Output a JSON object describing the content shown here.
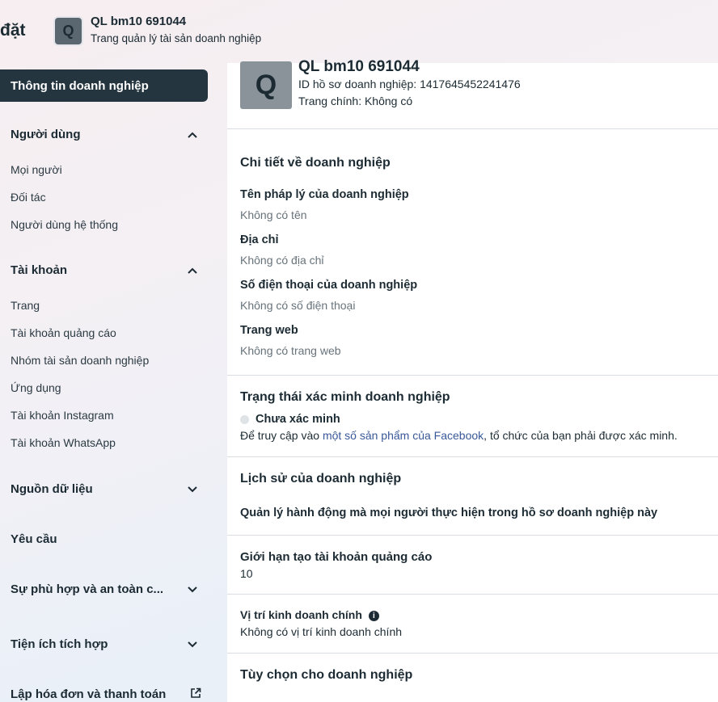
{
  "header": {
    "crumb_title": "đặt",
    "avatar_letter": "Q",
    "business_name": "QL bm10 691044",
    "subtitle": "Trang quản lý tài sản doanh nghiệp"
  },
  "sidebar": {
    "active_item": "Thông tin doanh nghiệp",
    "sections": {
      "users": {
        "label": "Người dùng",
        "items": [
          "Mọi người",
          "Đối tác",
          "Người dùng hệ thống"
        ]
      },
      "accounts": {
        "label": "Tài khoản",
        "items": [
          "Trang",
          "Tài khoản quảng cáo",
          "Nhóm tài sản doanh nghiệp",
          "Ứng dụng",
          "Tài khoản Instagram",
          "Tài khoản WhatsApp"
        ]
      },
      "data_sources": {
        "label": "Nguồn dữ liệu"
      },
      "requests": {
        "label": "Yêu cầu"
      },
      "compliance": {
        "label": "Sự phù hợp và an toàn c..."
      },
      "integrations": {
        "label": "Tiện ích tích hợp"
      },
      "billing": {
        "label": "Lập hóa đơn và thanh toán"
      }
    }
  },
  "main": {
    "profile": {
      "avatar_letter": "Q",
      "name": "QL bm10 691044",
      "id_line": "ID hồ sơ doanh nghiệp: 1417645452241476",
      "page_line": "Trang chính: Không có"
    },
    "details": {
      "heading": "Chi tiết về doanh nghiệp",
      "legal_name_label": "Tên pháp lý của doanh nghiệp",
      "legal_name_value": "Không có tên",
      "address_label": "Địa chỉ",
      "address_value": "Không có địa chỉ",
      "phone_label": "Số điện thoại của doanh nghiệp",
      "phone_value": "Không có số điện thoại",
      "website_label": "Trang web",
      "website_value": "Không có trang web"
    },
    "verification": {
      "heading": "Trạng thái xác minh doanh nghiệp",
      "status": "Chưa xác minh",
      "note_prefix": "Để truy cập vào ",
      "note_link": "một số sản phẩm của Facebook",
      "note_suffix": ", tổ chức của bạn phải được xác minh."
    },
    "history": {
      "heading": "Lịch sử của doanh nghiệp",
      "manage_text": "Quản lý hành động mà mọi người thực hiện trong hồ sơ doanh nghiệp này"
    },
    "ad_limit": {
      "heading": "Giới hạn tạo tài khoản quảng cáo",
      "value": "10"
    },
    "primary_location": {
      "heading": "Vị trí kinh doanh chính",
      "value": "Không có vị trí kinh doanh chính"
    },
    "options": {
      "heading": "Tùy chọn cho doanh nghiệp"
    }
  }
}
